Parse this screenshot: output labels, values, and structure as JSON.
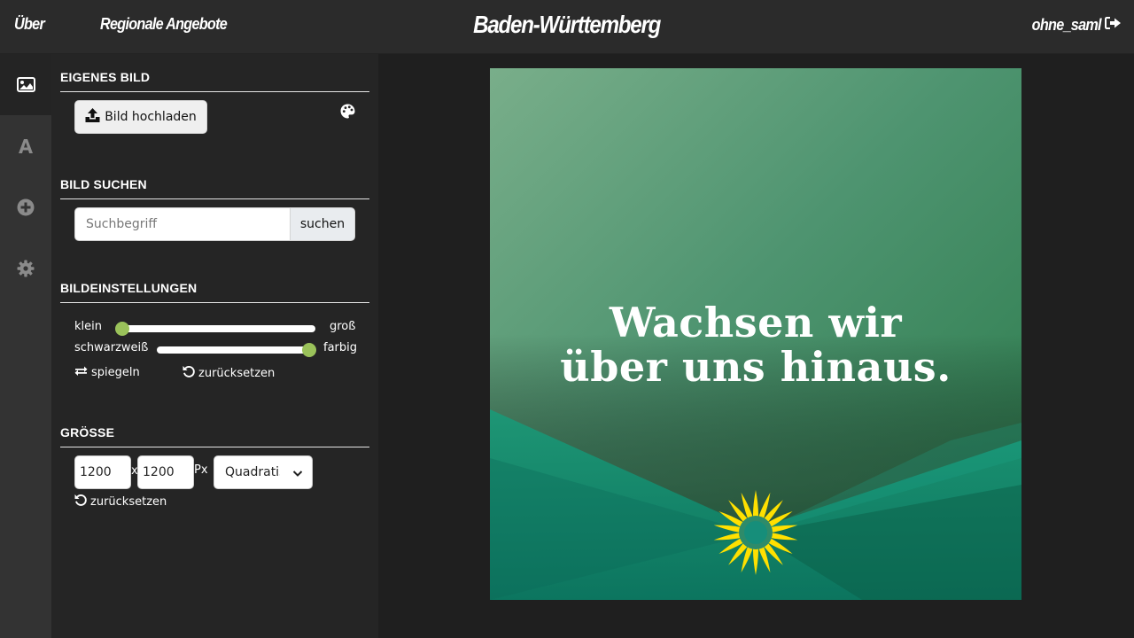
{
  "header": {
    "nav_about": "Über",
    "nav_regional": "Regionale Angebote",
    "brand": "Baden-Württemberg",
    "user": "ohne_saml",
    "logout_icon": "logout-arrow-icon"
  },
  "rail": {
    "items": [
      {
        "icon": "image-icon",
        "active": true
      },
      {
        "icon": "text-icon",
        "active": false
      },
      {
        "icon": "add-circle-icon",
        "active": false
      },
      {
        "icon": "gear-icon",
        "active": false
      }
    ]
  },
  "panel": {
    "own_image": {
      "title": "EIGENES BILD",
      "upload_label": "Bild hochladen",
      "palette_icon": "palette-icon"
    },
    "search": {
      "title": "BILD SUCHEN",
      "placeholder": "Suchbegriff",
      "value": "",
      "button_label": "suchen"
    },
    "settings": {
      "title": "BILDEINSTELLUNGEN",
      "size_slider": {
        "min_label": "klein",
        "max_label": "groß",
        "value": 0.0
      },
      "color_slider": {
        "min_label": "schwarzweiß",
        "max_label": "farbig",
        "value": 1.0
      },
      "mirror_label": "spiegeln",
      "reset_label": "zurücksetzen"
    },
    "size": {
      "title": "GRÖSSE",
      "width": "1200",
      "height": "1200",
      "separator": "x",
      "unit": "Px",
      "format_selected": "Quadratisch",
      "reset_label": "zurücksetzen"
    }
  },
  "canvas": {
    "headline_line1": "Wachsen wir",
    "headline_line2": "über uns hinaus.",
    "accent_yellow": "#ffe000",
    "accent_green": "#9ac25a"
  }
}
